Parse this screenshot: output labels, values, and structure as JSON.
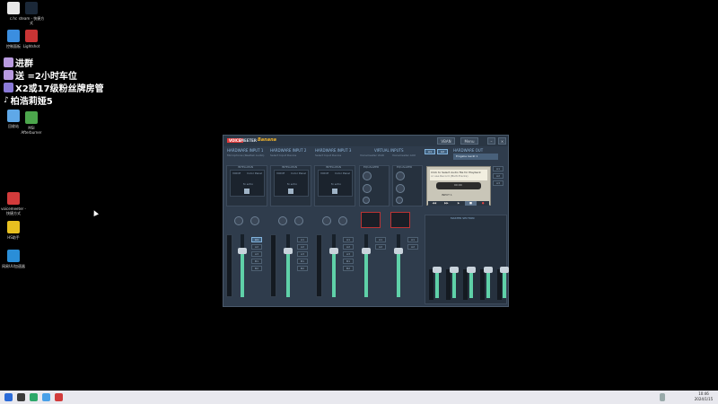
{
  "desktop": {
    "icons": [
      {
        "label": "c.hc",
        "color": "#e8e8e8"
      },
      {
        "label": "steam - 快捷方式",
        "color": "#1b2838"
      },
      {
        "label": "控制面板",
        "color": "#3b8ee0"
      },
      {
        "label": "Lightshot",
        "color": "#c93434"
      },
      {
        "label": "回收站",
        "color": "#5fa8e8"
      },
      {
        "label": "MSI Afterburner",
        "color": "#4ca64c"
      },
      {
        "label": "voicemeeter - 快捷方式",
        "color": "#d23b3b"
      },
      {
        "label": "HS助手",
        "color": "#e8c020"
      },
      {
        "label": "网易UU加速器",
        "color": "#2a8ed8"
      }
    ],
    "overlay_lines": [
      "进群",
      "送 =2小时车位",
      "X2或17级粉丝牌房管",
      "柏浩莉娅5"
    ]
  },
  "voicemeeter": {
    "brand": "VOICE",
    "product": "MEETER",
    "edition": "Banana",
    "vban_btn": "VBAN",
    "menu_btn": "Menu",
    "strips": [
      {
        "title": "HARDWARE INPUT 1",
        "sub": "Microphone (Realtek Audio)",
        "ctrl": "INTELLIPAN",
        "voice": "VOICE",
        "color_panel": "Color Panel",
        "fx": "fx echo",
        "label": "Fader Gain"
      },
      {
        "title": "HARDWARE INPUT 2",
        "sub": "Select Input Device",
        "ctrl": "INTELLIPAN",
        "voice": "VOICE",
        "color_panel": "Color Panel",
        "fx": "fx echo",
        "label": "Fader Gain"
      },
      {
        "title": "HARDWARE INPUT 3",
        "sub": "Select Input Device",
        "ctrl": "INTELLIPAN",
        "voice": "VOICE",
        "color_panel": "Color Panel",
        "fx": "fx echo",
        "label": "Fader Gain"
      }
    ],
    "virtual": {
      "title": "VIRTUAL INPUTS",
      "sub1": "Voicemeeter VAIO",
      "sub2": "Voicemeeter AUX",
      "eq": "EQUALIZER"
    },
    "hw_out": {
      "title": "HARDWARE OUT",
      "buses": [
        "A1",
        "A2",
        "A3"
      ],
      "device": "Eingabe Gerät 1"
    },
    "cassette": {
      "line1": "Click to Select Audio file for Playback",
      "line2": "or use Record (Multi-Tracks)",
      "time": "00:00",
      "input": "INPUT 1"
    },
    "master": {
      "title": "MASTER SECTION",
      "labels": [
        "A1",
        "A2",
        "A3",
        "B1",
        "B2"
      ]
    },
    "strip_buses": [
      "A1",
      "A2",
      "A3",
      "B1",
      "B2"
    ]
  },
  "taskbar": {
    "time": "10:46",
    "date": "2024/1/15"
  }
}
